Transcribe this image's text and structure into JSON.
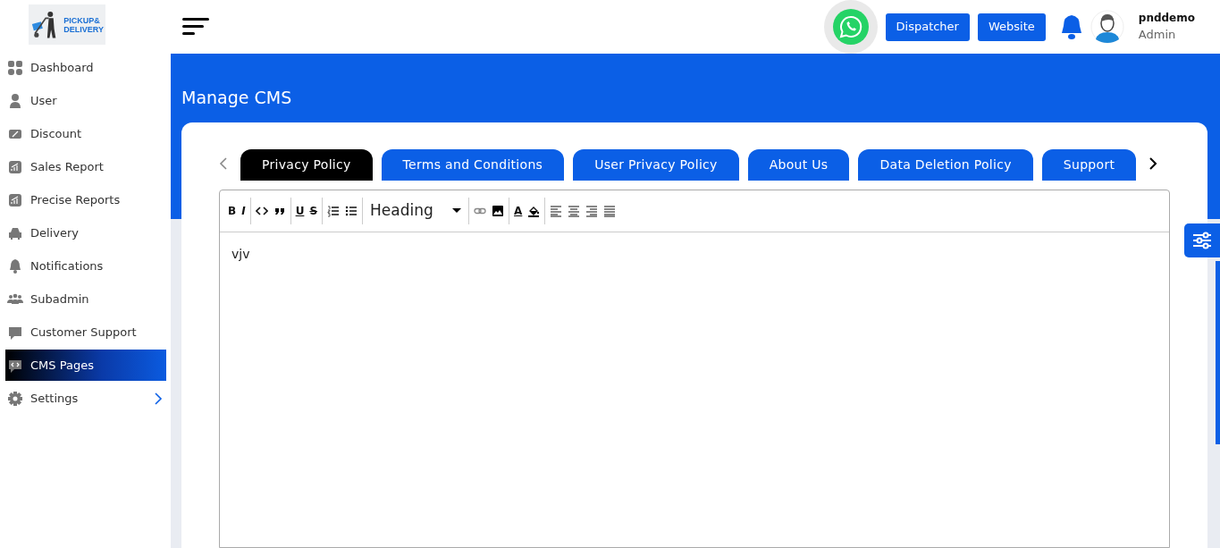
{
  "logo": {
    "line1": "PICKUP&",
    "line2": "DELIVERY"
  },
  "sidebar": {
    "items": [
      {
        "label": "Dashboard",
        "selected": false,
        "has_submenu": false
      },
      {
        "label": "User",
        "selected": false,
        "has_submenu": false
      },
      {
        "label": "Discount",
        "selected": false,
        "has_submenu": false
      },
      {
        "label": "Sales Report",
        "selected": false,
        "has_submenu": false
      },
      {
        "label": "Precise Reports",
        "selected": false,
        "has_submenu": false
      },
      {
        "label": "Delivery",
        "selected": false,
        "has_submenu": false
      },
      {
        "label": "Notifications",
        "selected": false,
        "has_submenu": false
      },
      {
        "label": "Subadmin",
        "selected": false,
        "has_submenu": false
      },
      {
        "label": "Customer Support",
        "selected": false,
        "has_submenu": false
      },
      {
        "label": "CMS Pages",
        "selected": true,
        "has_submenu": false
      },
      {
        "label": "Settings",
        "selected": false,
        "has_submenu": true
      }
    ]
  },
  "header": {
    "buttons": [
      "Dispatcher",
      "Website"
    ],
    "user": {
      "name": "pnddemo",
      "role": "Admin"
    }
  },
  "page_title": "Manage CMS",
  "tabs": [
    {
      "label": "Privacy Policy",
      "selected": true
    },
    {
      "label": "Terms and Conditions",
      "selected": false
    },
    {
      "label": "User Privacy Policy",
      "selected": false
    },
    {
      "label": "About Us",
      "selected": false
    },
    {
      "label": "Data Deletion Policy",
      "selected": false
    },
    {
      "label": "Support",
      "selected": false
    }
  ],
  "editor": {
    "toolbar": [
      [
        {
          "kind": "bold",
          "label": "B"
        },
        {
          "kind": "italic",
          "label": "I"
        }
      ],
      [
        {
          "kind": "code"
        },
        {
          "kind": "quote"
        }
      ],
      [
        {
          "kind": "underline",
          "label": "U"
        },
        {
          "kind": "strike",
          "label": "S"
        }
      ],
      [
        {
          "kind": "ol"
        },
        {
          "kind": "ul"
        }
      ],
      [
        {
          "kind": "select",
          "label": "Heading"
        }
      ],
      [
        {
          "kind": "link"
        },
        {
          "kind": "image"
        }
      ],
      [
        {
          "kind": "color",
          "label": "A"
        },
        {
          "kind": "bgcolor"
        }
      ],
      [
        {
          "kind": "left"
        },
        {
          "kind": "center"
        },
        {
          "kind": "right"
        },
        {
          "kind": "justify"
        }
      ]
    ],
    "content": "vjv"
  }
}
